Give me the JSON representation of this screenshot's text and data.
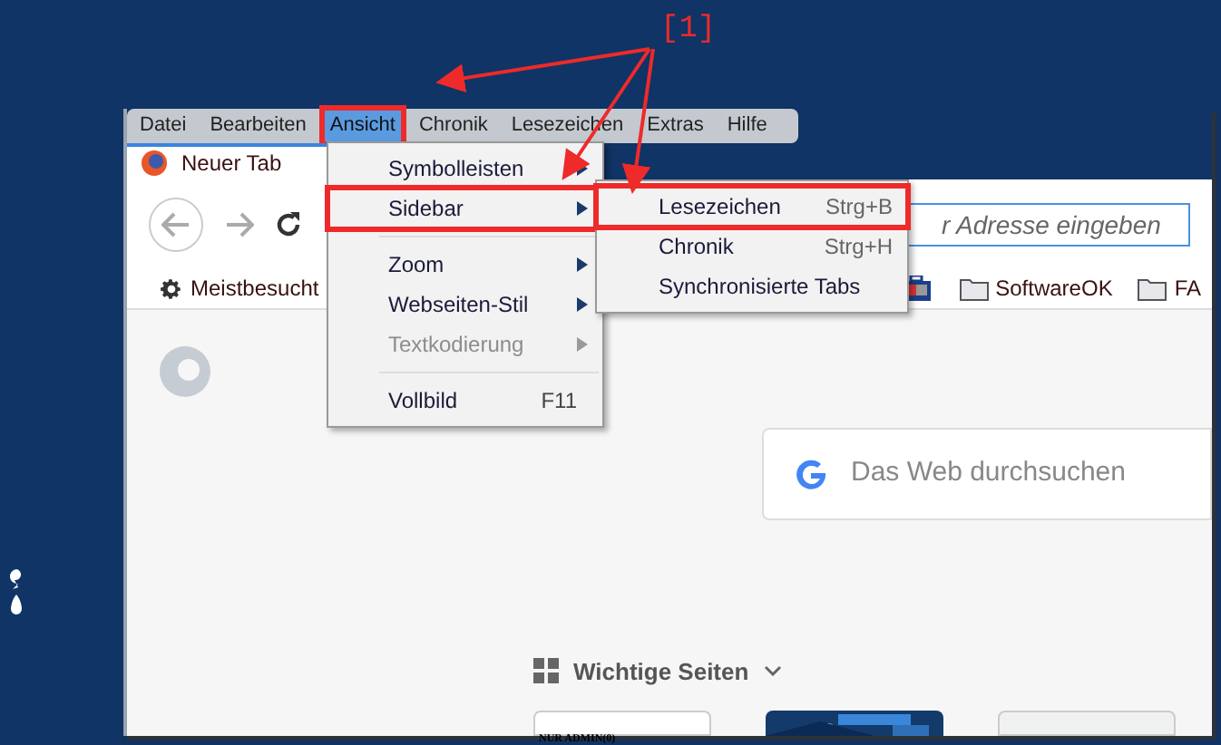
{
  "annotation": {
    "label": "[1]"
  },
  "menu_bar": [
    {
      "label": "Datei",
      "selected": false,
      "annotated": false
    },
    {
      "label": "Bearbeiten",
      "selected": false,
      "annotated": false
    },
    {
      "label": "Ansicht",
      "selected": true,
      "annotated": true
    },
    {
      "label": "Chronik",
      "selected": false,
      "annotated": false
    },
    {
      "label": "Lesezeichen",
      "selected": false,
      "annotated": false
    },
    {
      "label": "Extras",
      "selected": false,
      "annotated": false
    },
    {
      "label": "Hilfe",
      "selected": false,
      "annotated": false
    }
  ],
  "tab": {
    "title": "Neuer Tab"
  },
  "address_bar": {
    "placeholder": "r Adresse eingeben"
  },
  "bookmarks": [
    {
      "kind": "special",
      "label": "Meistbesucht"
    },
    {
      "kind": "app"
    },
    {
      "kind": "folder",
      "label": "SoftwareOK"
    },
    {
      "kind": "folder",
      "label": "FA"
    }
  ],
  "view_menu": [
    {
      "kind": "item",
      "label": "Symbolleisten",
      "submenu": true,
      "disabled": false,
      "annotated": false
    },
    {
      "kind": "item",
      "label": "Sidebar",
      "submenu": true,
      "disabled": false,
      "annotated": true
    },
    {
      "kind": "separator"
    },
    {
      "kind": "item",
      "label": "Zoom",
      "submenu": true,
      "disabled": false,
      "annotated": false
    },
    {
      "kind": "item",
      "label": "Webseiten-Stil",
      "submenu": true,
      "disabled": false,
      "annotated": false
    },
    {
      "kind": "item",
      "label": "Textkodierung",
      "submenu": true,
      "disabled": true,
      "annotated": false
    },
    {
      "kind": "separator"
    },
    {
      "kind": "item",
      "label": "Vollbild",
      "shortcut": "F11",
      "submenu": false,
      "disabled": false,
      "annotated": false
    }
  ],
  "sidebar_menu": [
    {
      "label": "Lesezeichen",
      "shortcut": "Strg+B",
      "annotated": true
    },
    {
      "label": "Chronik",
      "shortcut": "Strg+H",
      "annotated": false
    },
    {
      "label": "Synchronisierte Tabs",
      "annotated": false
    }
  ],
  "search": {
    "placeholder": "Das Web durchsuchen"
  },
  "top_sites": {
    "heading": "Wichtige Seiten",
    "tiles": [
      {
        "kind": "text",
        "label": "NUR ADMIN(0)"
      },
      {
        "kind": "picture"
      },
      {
        "kind": "blank"
      }
    ]
  }
}
